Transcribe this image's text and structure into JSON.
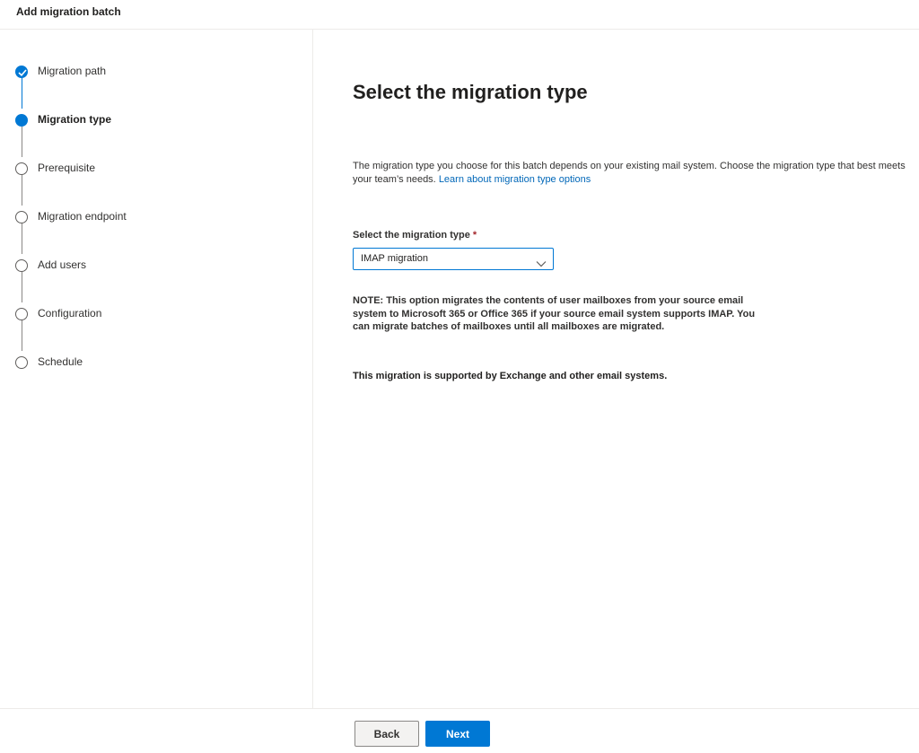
{
  "header": {
    "title": "Add migration batch"
  },
  "steps": [
    {
      "label": "Migration path",
      "state": "done"
    },
    {
      "label": "Migration type",
      "state": "current"
    },
    {
      "label": "Prerequisite",
      "state": "pending"
    },
    {
      "label": "Migration endpoint",
      "state": "pending"
    },
    {
      "label": "Add users",
      "state": "pending"
    },
    {
      "label": "Configuration",
      "state": "pending"
    },
    {
      "label": "Schedule",
      "state": "pending"
    }
  ],
  "main": {
    "title": "Select the migration type",
    "description": "The migration type you choose for this batch depends on your existing mail system. Choose the migration type that best meets your team’s needs.",
    "learn_link": "Learn about migration type options",
    "field_label": "Select the migration type",
    "required_mark": "*",
    "dropdown_value": "IMAP migration",
    "note_label": "NOTE:",
    "note_text": "This option migrates the contents of user mailboxes from your source email system to Microsoft 365 or Office 365 if your source email system supports IMAP. You can migrate batches of mailboxes until all mailboxes are migrated.",
    "support_text": "This migration is supported by Exchange and other email systems."
  },
  "footer": {
    "back_label": "Back",
    "next_label": "Next"
  },
  "colors": {
    "accent": "#0078d4",
    "link": "#0067b8",
    "required": "#a4262c"
  }
}
